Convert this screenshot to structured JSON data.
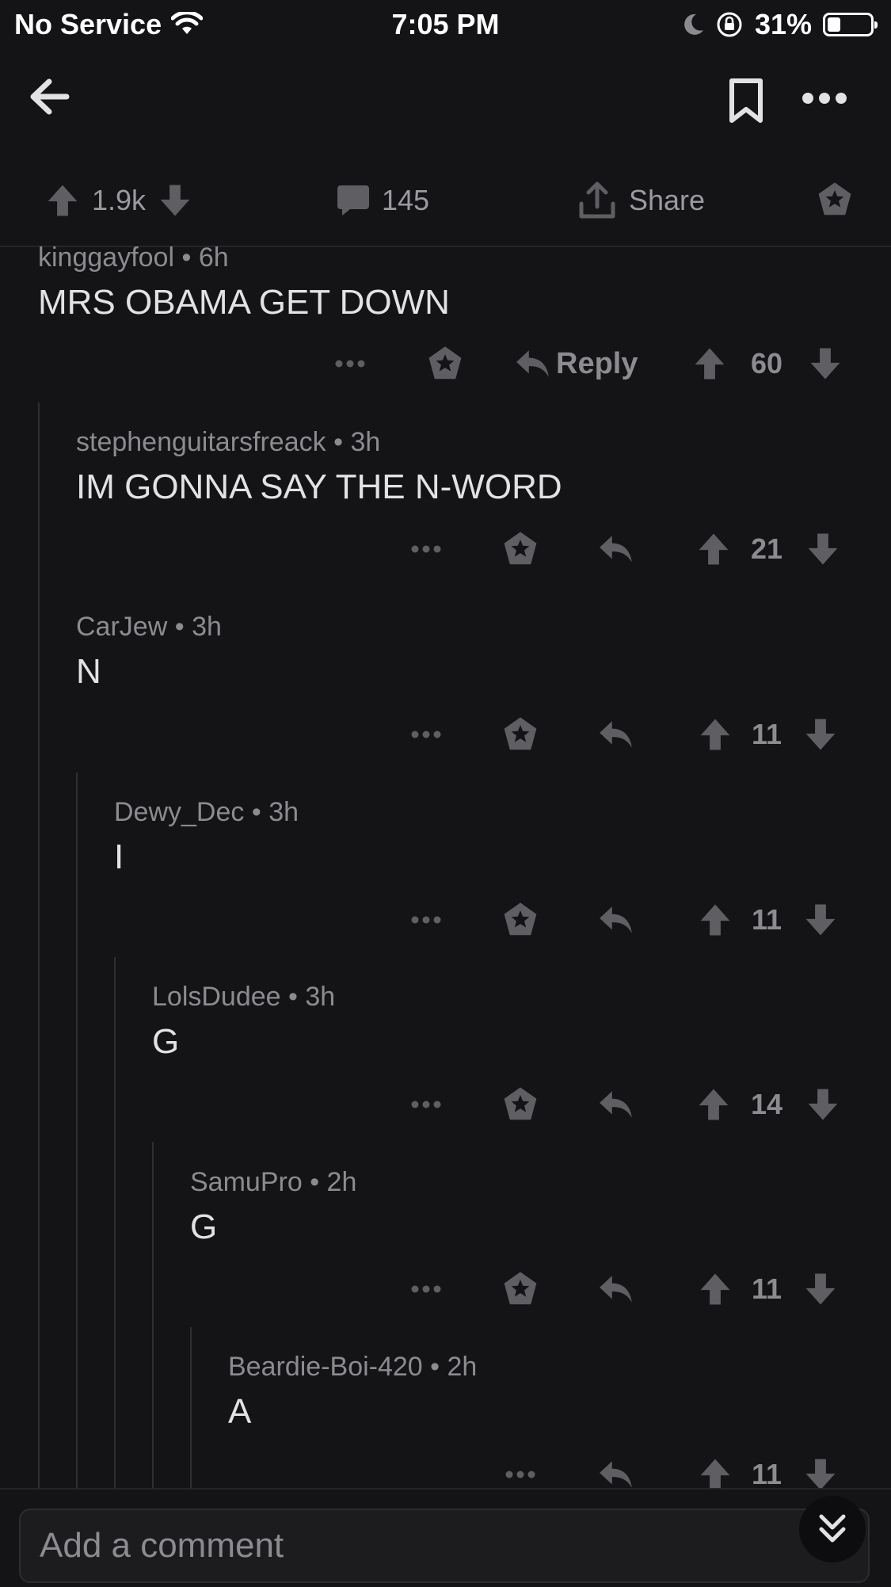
{
  "status_bar": {
    "carrier": "No Service",
    "time": "7:05 PM",
    "battery": "31%",
    "battery_level": 0.31
  },
  "nav": {
    "back_icon": "arrow-left-icon",
    "bookmark_icon": "bookmark-icon",
    "more_icon": "more-horizontal-icon"
  },
  "post_actions": {
    "upvotes": "1.9k",
    "comments": "145",
    "share": "Share"
  },
  "comments": [
    {
      "author": "kinggayfool",
      "sep": "•",
      "age": "6h",
      "text": "MRS OBAMA GET DOWN",
      "votes": "60",
      "reply_label": "Reply"
    },
    {
      "author": "stephenguitarsfreack",
      "sep": "•",
      "age": "3h",
      "text": "IM GONNA SAY THE N-WORD",
      "votes": "21"
    },
    {
      "author": "CarJew",
      "sep": "•",
      "age": "3h",
      "text": "N",
      "votes": "11"
    },
    {
      "author": "Dewy_Dec",
      "sep": "•",
      "age": "3h",
      "text": "I",
      "votes": "11"
    },
    {
      "author": "LolsDudee",
      "sep": "•",
      "age": "3h",
      "text": "G",
      "votes": "14"
    },
    {
      "author": "SamuPro",
      "sep": "•",
      "age": "2h",
      "text": "G",
      "votes": "11"
    },
    {
      "author": "Beardie-Boi-420",
      "sep": "•",
      "age": "2h",
      "text": "A",
      "votes": "11"
    }
  ],
  "composer": {
    "placeholder": "Add a comment"
  },
  "colors": {
    "background": "#141416",
    "icon_gray": "#5e5e63",
    "text_secondary": "#8b8b90"
  }
}
